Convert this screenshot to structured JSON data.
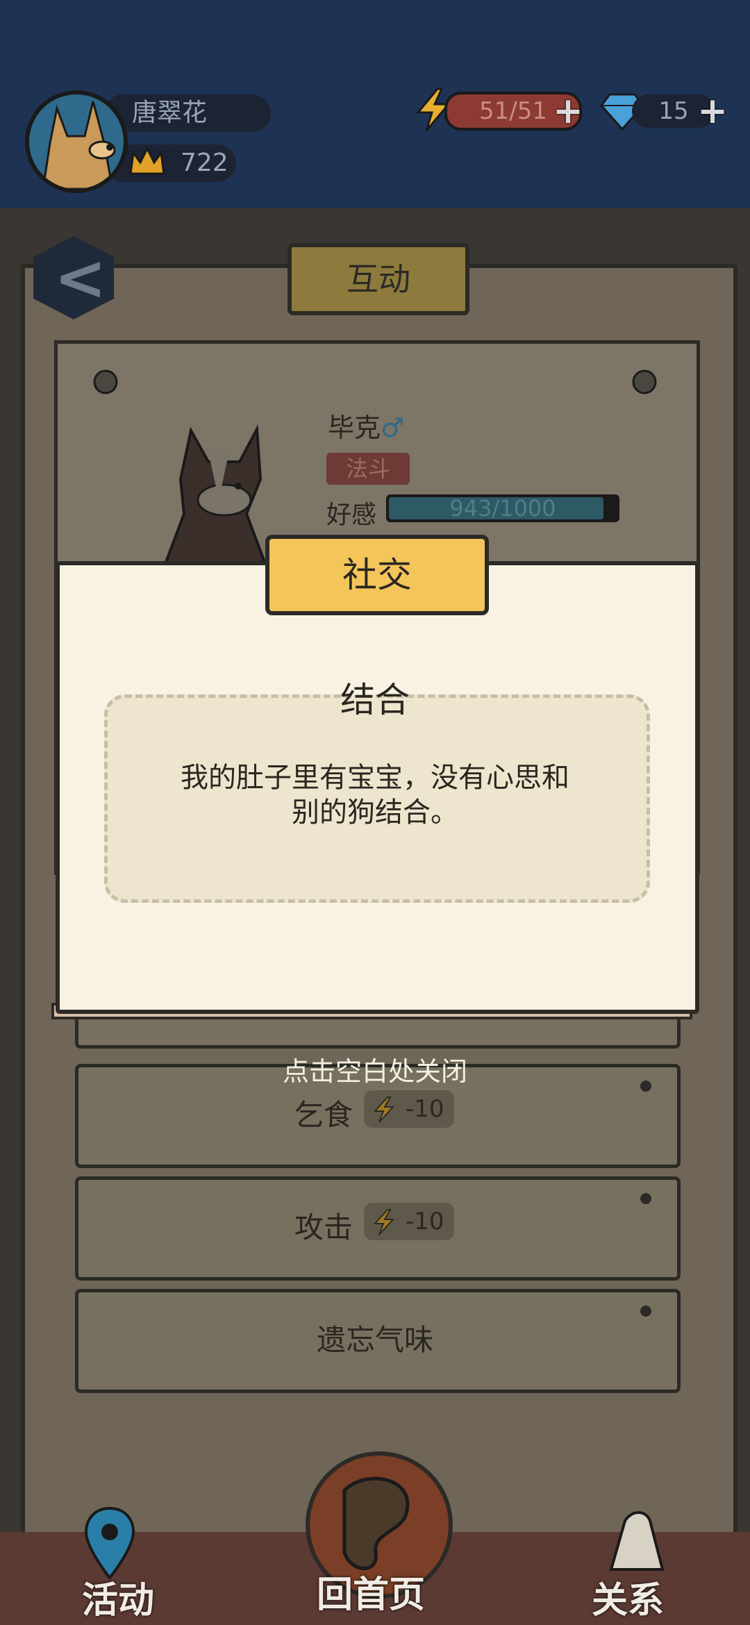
{
  "topbar": {
    "username": "唐翠花",
    "crown_count": "722",
    "energy": "51/51",
    "gems": "15",
    "plus_symbol": "+"
  },
  "header": {
    "title": "互动",
    "back_glyph": "<"
  },
  "dog": {
    "name": "毕克",
    "gender_symbol": "♂",
    "role": "法斗",
    "favor_label": "好感",
    "favor_text": "943/1000",
    "favor_value": 943,
    "favor_max": 1000
  },
  "actions": [
    {
      "label": "乞食",
      "cost": "-10"
    },
    {
      "label": "攻击",
      "cost": "-10"
    },
    {
      "label": "遗忘气味",
      "cost": ""
    }
  ],
  "close_hint": "点击空白处关闭",
  "modal": {
    "ribbon": "社交",
    "title": "结合",
    "message_line1": "我的肚子里有宝宝，没有心思和",
    "message_line2": "别的狗结合。"
  },
  "nav": {
    "activities": "活动",
    "home": "回首页",
    "relations": "关系"
  },
  "colors": {
    "topbar": "#1e3354",
    "modal_bg": "#f7f2e2",
    "ribbon": "#f3c55a",
    "energy": "#8c3a33"
  }
}
